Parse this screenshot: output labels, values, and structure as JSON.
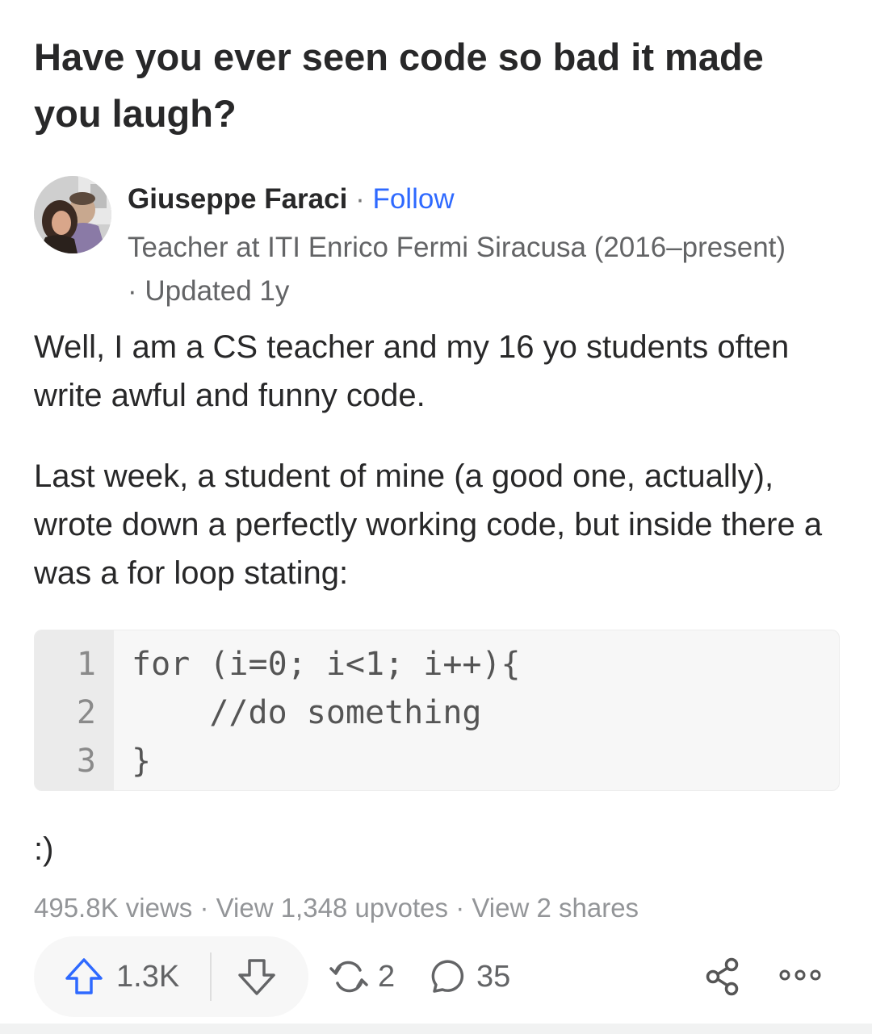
{
  "question": {
    "title": "Have you ever seen code so bad it made you laugh?"
  },
  "author": {
    "name": "Giuseppe Faraci",
    "separator": "·",
    "follow_label": "Follow",
    "credential": "Teacher at ITI Enrico Fermi Siracusa (2016–present)",
    "updated": "· Updated 1y"
  },
  "answer": {
    "paragraphs": [
      "Well, I am a CS teacher and my 16 yo students often write awful and funny code.",
      "Last week, a student of mine (a good one, actually), wrote down a perfectly working code, but inside there a was a for loop stating:"
    ],
    "code": {
      "line_numbers": [
        "1",
        "2",
        "3"
      ],
      "lines": [
        "for (i=0; i<1; i++){",
        "    //do something",
        "}"
      ]
    },
    "closing": ":)"
  },
  "stats": {
    "views": "495.8K views",
    "upvotes_link": "View 1,348 upvotes",
    "shares_link": "View 2 shares",
    "separator": " · "
  },
  "actions": {
    "upvote_count": "1.3K",
    "share_count": "2",
    "comment_count": "35",
    "icons": {
      "upvote": "arrow-up-outline-icon",
      "downvote": "arrow-down-outline-icon",
      "reshare": "refresh-cycle-icon",
      "comment": "speech-bubble-icon",
      "share": "share-nodes-icon",
      "more": "more-dots-icon"
    },
    "colors": {
      "upvote": "#2e69ff",
      "icon": "#636466"
    }
  },
  "colors": {
    "link": "#2e69ff",
    "text": "#282829",
    "muted": "#939598"
  }
}
